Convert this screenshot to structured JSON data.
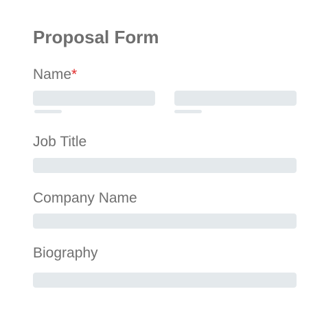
{
  "form": {
    "title": "Proposal Form",
    "fields": {
      "name": {
        "label": "Name",
        "required_marker": "*",
        "first_value": "",
        "last_value": ""
      },
      "job_title": {
        "label": "Job Title",
        "value": ""
      },
      "company_name": {
        "label": "Company Name",
        "value": ""
      },
      "biography": {
        "label": "Biography",
        "value": ""
      }
    }
  },
  "colors": {
    "field_background": "#e4e9ec",
    "required_marker": "#e02b2b",
    "text": "#707070"
  }
}
